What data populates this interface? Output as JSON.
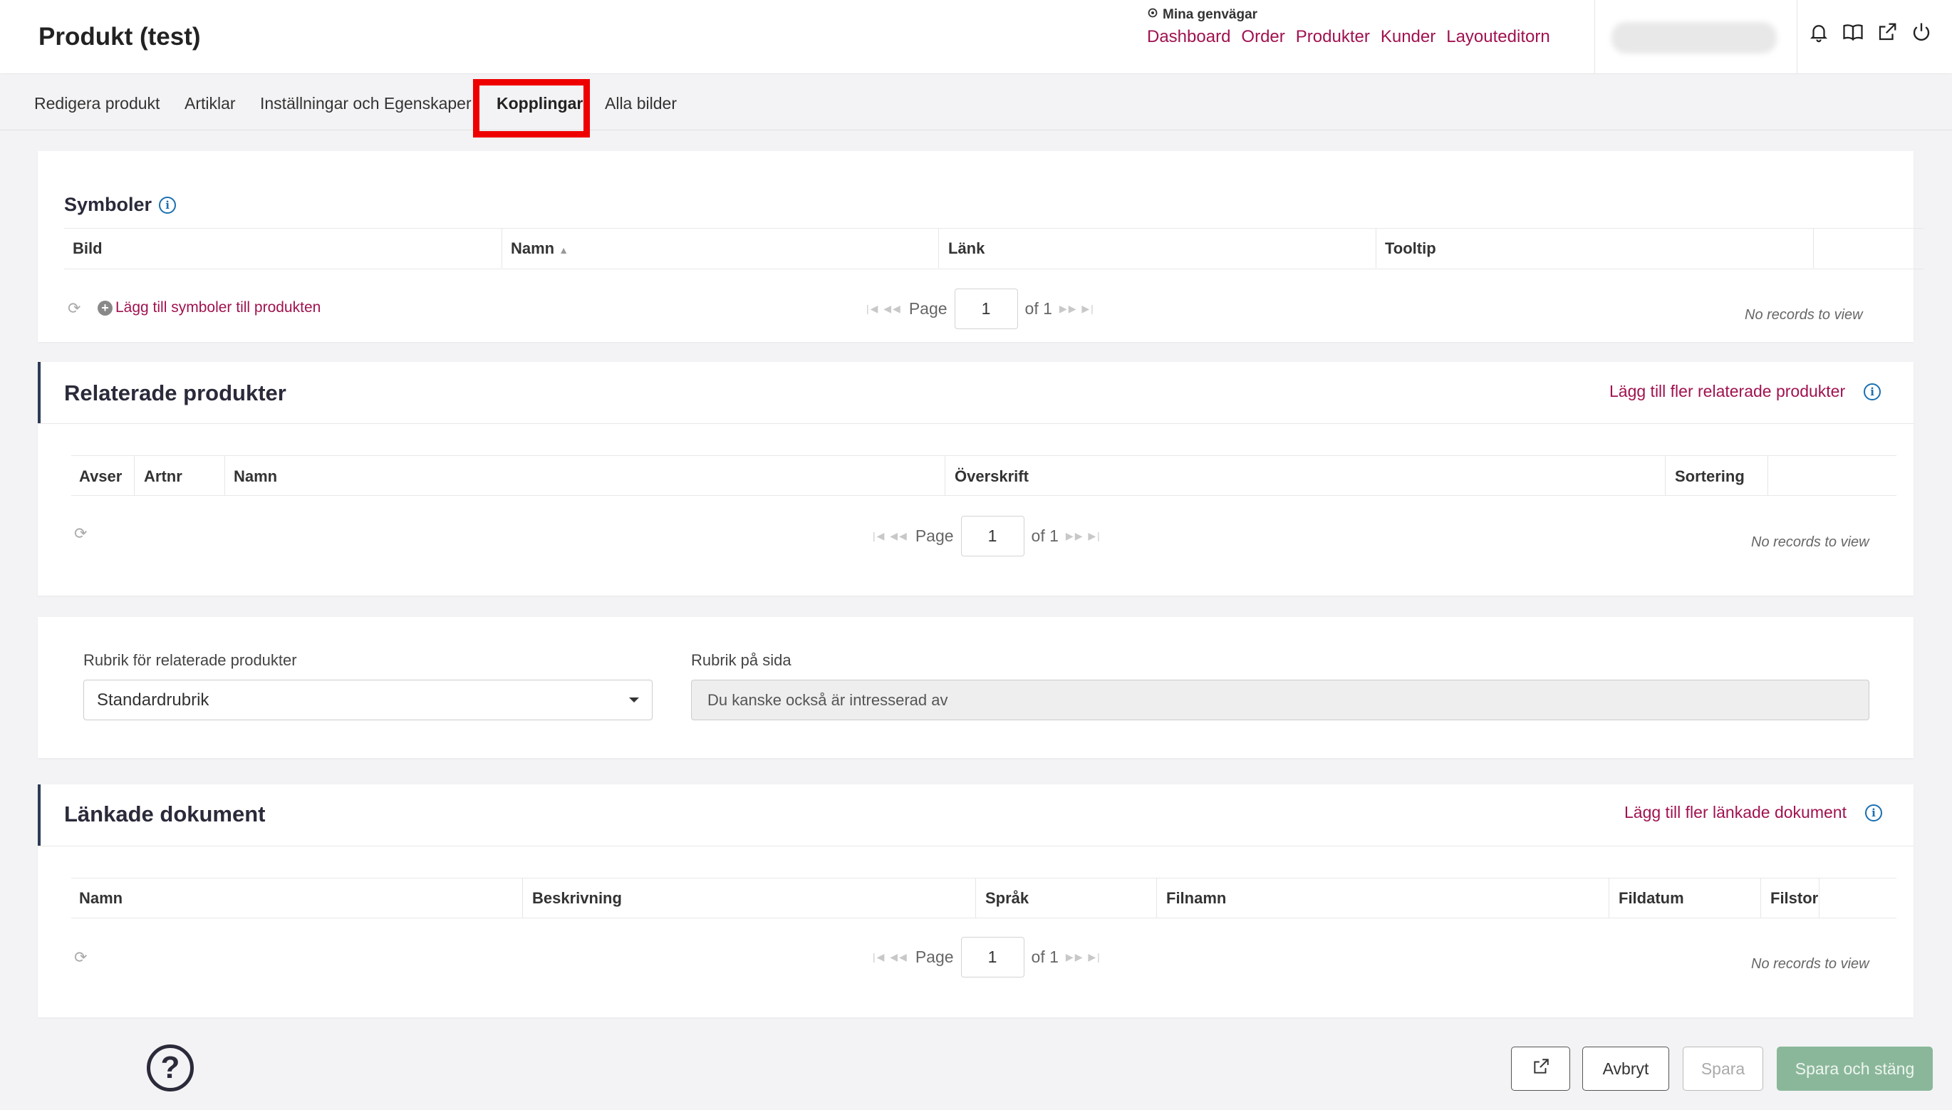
{
  "app": {
    "title": "Produkt (test)"
  },
  "shortcuts": {
    "title": "Mina genvägar",
    "links": [
      "Dashboard",
      "Order",
      "Produkter",
      "Kunder",
      "Layouteditorn"
    ]
  },
  "top_icons": [
    "bell-icon",
    "book-icon",
    "external-link-icon",
    "power-icon"
  ],
  "tabs": [
    {
      "label": "Redigera produkt",
      "active": false
    },
    {
      "label": "Artiklar",
      "active": false
    },
    {
      "label": "Inställningar och Egenskaper",
      "active": false
    },
    {
      "label": "Kopplingar",
      "active": true
    },
    {
      "label": "Alla bilder",
      "active": false
    }
  ],
  "symbols": {
    "title": "Symboler",
    "columns": [
      "Bild",
      "Namn",
      "Länk",
      "Tooltip"
    ],
    "add_label": "Lägg till symboler till produkten",
    "pager": {
      "page_label": "Page",
      "page": "1",
      "of_label": "of 1"
    },
    "no_records": "No records to view"
  },
  "related": {
    "title": "Relaterade produkter",
    "action": "Lägg till fler relaterade produkter",
    "columns": [
      "Avser",
      "Artnr",
      "Namn",
      "Överskrift",
      "Sortering"
    ],
    "pager": {
      "page_label": "Page",
      "page": "1",
      "of_label": "of 1"
    },
    "no_records": "No records to view"
  },
  "headings": {
    "rubrik_label": "Rubrik för relaterade produkter",
    "rubrik_value": "Standardrubrik",
    "page_heading_label": "Rubrik på sida",
    "page_heading_value": "Du kanske också är intresserad av"
  },
  "documents": {
    "title": "Länkade dokument",
    "action": "Lägg till fler länkade dokument",
    "columns": [
      "Namn",
      "Beskrivning",
      "Språk",
      "Filnamn",
      "Fildatum",
      "Filstor"
    ],
    "pager": {
      "page_label": "Page",
      "page": "1",
      "of_label": "of 1"
    },
    "no_records": "No records to view"
  },
  "footer": {
    "help": "?",
    "cancel": "Avbryt",
    "save": "Spara",
    "save_close": "Spara och stäng"
  },
  "colors": {
    "accent": "#a0124f",
    "primary_button": "#8ab79a",
    "heading": "#2a2a3a"
  }
}
